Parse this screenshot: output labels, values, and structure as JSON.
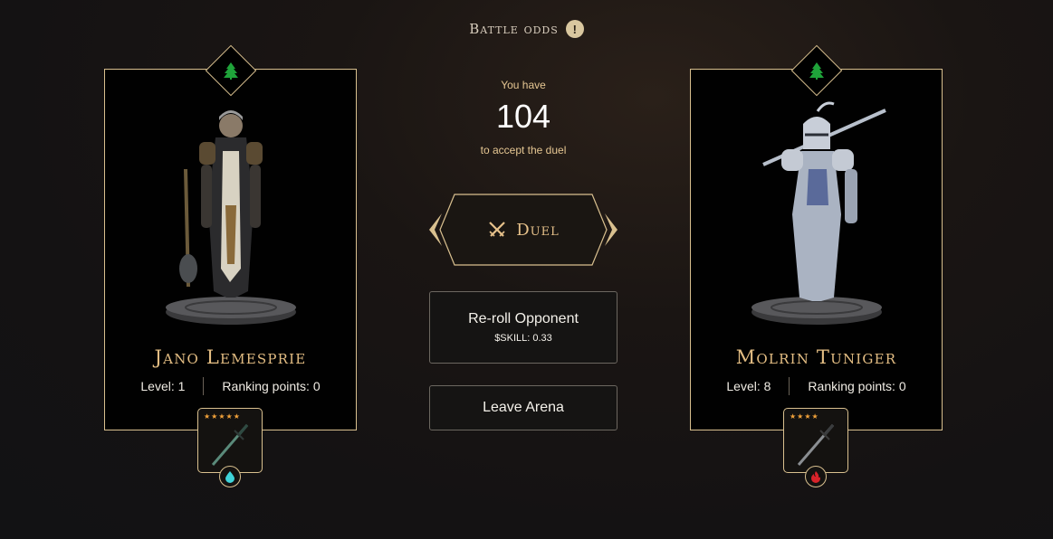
{
  "header": {
    "title": "Battle odds",
    "info_icon": "!"
  },
  "center": {
    "you_have": "You have",
    "timer": "104",
    "to_accept": "to accept the duel",
    "duel_label": "Duel",
    "reroll_label": "Re-roll Opponent",
    "reroll_cost": "$SKILL: 0.33",
    "leave_label": "Leave Arena"
  },
  "player": {
    "name": "Jano Lemesprie",
    "level": "Level: 1",
    "ranking": "Ranking points: 0",
    "class_icon": "tree-icon",
    "weapon": {
      "stars": "★★★★★",
      "rarity": 5,
      "element_icon": "water-drop-icon",
      "element_color": "#3fd3d9"
    }
  },
  "opponent": {
    "name": "Molrin Tuniger",
    "level": "Level: 8",
    "ranking": "Ranking points: 0",
    "class_icon": "tree-icon",
    "weapon": {
      "stars": "★★★★",
      "rarity": 4,
      "element_icon": "fire-icon",
      "element_color": "#d8232a"
    }
  },
  "colors": {
    "gold": "#d9c08f",
    "accent": "#e3bd83",
    "class_green": "#1fa33a"
  }
}
